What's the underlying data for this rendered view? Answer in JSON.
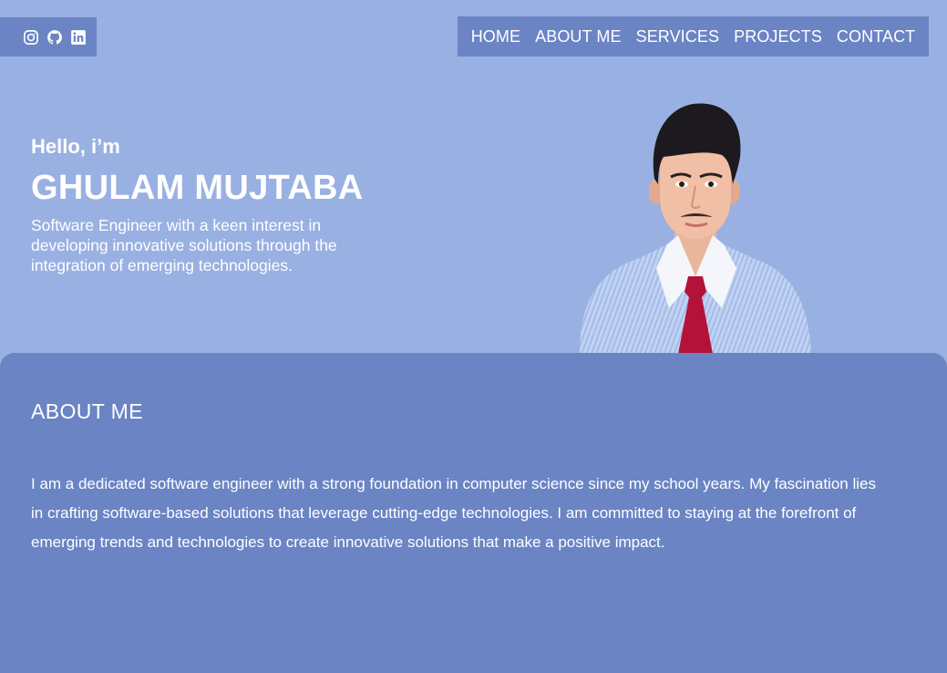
{
  "social": {
    "icons": [
      "instagram-icon",
      "github-icon",
      "linkedin-icon"
    ]
  },
  "nav": {
    "items": [
      "HOME",
      "ABOUT ME",
      "SERVICES",
      "PROJECTS",
      "CONTACT"
    ]
  },
  "hero": {
    "greeting": "Hello, i’m",
    "name": "GHULAM MUJTABA",
    "tagline": "Software Engineer with a keen interest in developing innovative solutions through the integration of emerging technologies."
  },
  "about": {
    "title": "ABOUT ME",
    "body": "I am a dedicated software engineer with a strong foundation in computer science since my school years. My fascination lies in crafting software-based solutions that leverage cutting-edge technologies. I am committed to staying at the forefront of emerging trends and technologies to create innovative solutions that make a positive impact."
  },
  "colors": {
    "background": "#99b0e2",
    "panel": "#6a84c4",
    "text": "#ffffff"
  }
}
